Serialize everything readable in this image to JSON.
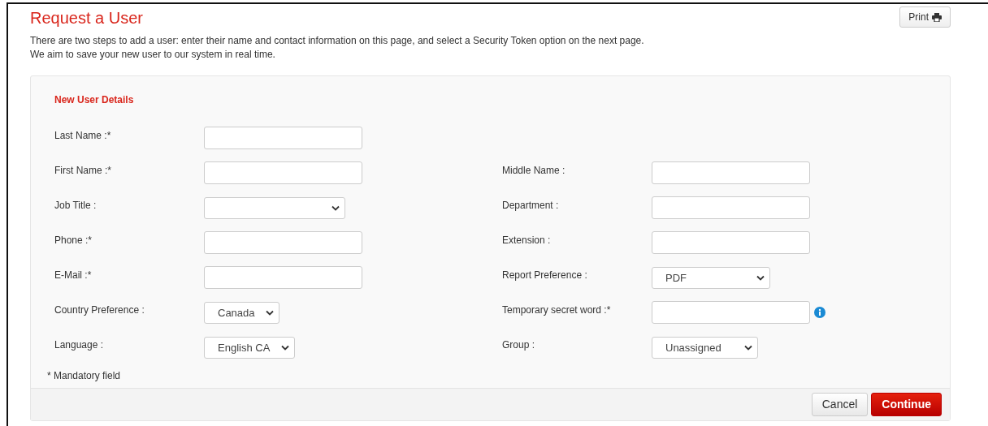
{
  "page": {
    "title": "Request a User",
    "print_button": "Print"
  },
  "intro": [
    "There are two steps to add a user: enter their name and contact information on this page, and select a Security Token option on the next page.",
    "We aim to save your new user to our system in real time."
  ],
  "form": {
    "heading": "New User Details",
    "rows": [
      {
        "left": {
          "label": "Last Name :*",
          "kind": "text"
        }
      },
      {
        "left": {
          "label": "First Name :*",
          "kind": "text"
        },
        "right": {
          "label": "Middle Name :",
          "kind": "text"
        }
      },
      {
        "left": {
          "label": "Job Title :",
          "kind": "select"
        },
        "right": {
          "label": "Department :",
          "kind": "text"
        }
      },
      {
        "left": {
          "label": "Phone :*",
          "kind": "text"
        },
        "right": {
          "label": "Extension :",
          "kind": "text"
        }
      },
      {
        "left": {
          "label": "E-Mail :*",
          "kind": "text"
        },
        "right": {
          "label": "Report Preference :",
          "kind": "select",
          "value": "PDF"
        }
      },
      {
        "left": {
          "label": "Country Preference :",
          "kind": "select",
          "value": "Canada"
        },
        "right": {
          "label": "Temporary secret word :*",
          "kind": "text",
          "info": true
        }
      },
      {
        "left": {
          "label": "Language :",
          "kind": "select",
          "value": "English CA"
        },
        "right": {
          "label": "Group :",
          "kind": "select",
          "value": "Unassigned"
        }
      }
    ],
    "note": "* Mandatory field"
  },
  "buttons": [
    {
      "label": "Cancel",
      "kind": "secondary"
    },
    {
      "label": "Continue",
      "kind": "primary"
    }
  ]
}
